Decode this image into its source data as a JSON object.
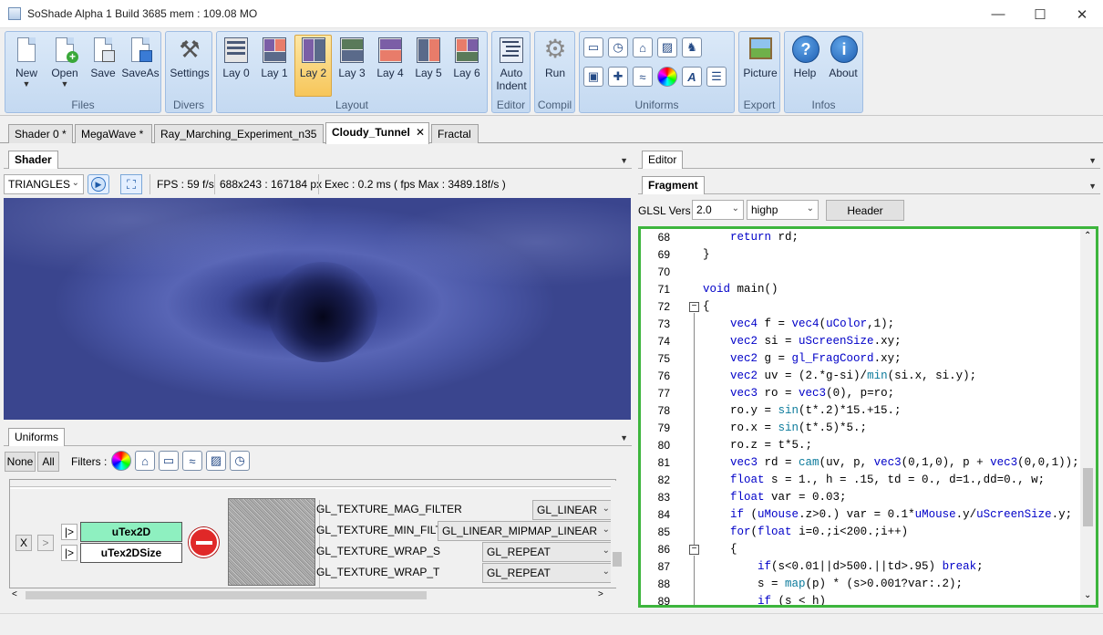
{
  "window": {
    "title": "SoShade Alpha 1 Build 3685 mem : 109.08 MO",
    "minimize": "—",
    "maximize": "☐",
    "close": "✕"
  },
  "ribbon": {
    "files": {
      "label": "Files",
      "new": "New",
      "open": "Open",
      "save": "Save",
      "saveas": "SaveAs"
    },
    "divers": {
      "label": "Divers",
      "settings": "Settings"
    },
    "layout": {
      "label": "Layout",
      "layouts": [
        "Lay 0",
        "Lay 1",
        "Lay 2",
        "Lay 3",
        "Lay 4",
        "Lay 5",
        "Lay 6"
      ],
      "active": "Lay 2"
    },
    "editor": {
      "label": "Editor",
      "auto_indent_1": "Auto",
      "auto_indent_2": "Indent"
    },
    "compil": {
      "label": "Compil",
      "run": "Run"
    },
    "uniforms": {
      "label": "Uniforms"
    },
    "export": {
      "label": "Export",
      "picture": "Picture"
    },
    "infos": {
      "label": "Infos",
      "help": "Help",
      "about": "About"
    }
  },
  "doc_tabs": [
    "Shader 0 *",
    "MegaWave *",
    "Ray_Marching_Experiment_n35",
    "Cloudy_Tunnel",
    "Fractal"
  ],
  "active_doc_tab": "Cloudy_Tunnel",
  "shader_panel": {
    "tab": "Shader",
    "mode": "TRIANGLES",
    "fps": "FPS : 59 f/s",
    "size": "688x243 : 167184 px",
    "exec": "Exec : 0.2 ms ( fps Max : 3489.18f/s )"
  },
  "uniforms_panel": {
    "tab": "Uniforms",
    "none": "None",
    "all": "All",
    "filters": "Filters :",
    "x": "X",
    "gt": ">",
    "play1": "|>",
    "play2": "|>",
    "tex_name": "uTex2D",
    "tex_size": "uTex2DSize",
    "params": [
      {
        "name": "GL_TEXTURE_MAG_FILTER",
        "value": "GL_LINEAR"
      },
      {
        "name": "GL_TEXTURE_MIN_FILTER",
        "value": "GL_LINEAR_MIPMAP_LINEAR"
      },
      {
        "name": "GL_TEXTURE_WRAP_S",
        "value": "GL_REPEAT"
      },
      {
        "name": "GL_TEXTURE_WRAP_T",
        "value": "GL_REPEAT"
      }
    ]
  },
  "editor_panel": {
    "tab": "Editor",
    "subtab": "Fragment",
    "glsl_label": "GLSL Vers :",
    "glsl_version": "2.0",
    "precision": "highp",
    "header_button": "Header",
    "lines": [
      {
        "n": "68",
        "code": "    return rd;"
      },
      {
        "n": "69",
        "code": "}"
      },
      {
        "n": "70",
        "code": ""
      },
      {
        "n": "71",
        "code": "void main()"
      },
      {
        "n": "72",
        "code": "{"
      },
      {
        "n": "73",
        "code": "    vec4 f = vec4(uColor,1);"
      },
      {
        "n": "74",
        "code": "    vec2 si = uScreenSize.xy;"
      },
      {
        "n": "75",
        "code": "    vec2 g = gl_FragCoord.xy;"
      },
      {
        "n": "76",
        "code": "    vec2 uv = (2.*g-si)/min(si.x, si.y);"
      },
      {
        "n": "77",
        "code": "    vec3 ro = vec3(0), p=ro;"
      },
      {
        "n": "78",
        "code": "    ro.y = sin(t*.2)*15.+15.;"
      },
      {
        "n": "79",
        "code": "    ro.x = sin(t*.5)*5.;"
      },
      {
        "n": "80",
        "code": "    ro.z = t*5.;"
      },
      {
        "n": "81",
        "code": "    vec3 rd = cam(uv, p, vec3(0,1,0), p + vec3(0,0,1));"
      },
      {
        "n": "82",
        "code": "    float s = 1., h = .15, td = 0., d=1.,dd=0., w;"
      },
      {
        "n": "83",
        "code": "    float var = 0.03;"
      },
      {
        "n": "84",
        "code": "    if (uMouse.z>0.) var = 0.1*uMouse.y/uScreenSize.y;"
      },
      {
        "n": "85",
        "code": "    for(float i=0.;i<200.;i++)"
      },
      {
        "n": "86",
        "code": "    {"
      },
      {
        "n": "87",
        "code": "        if(s<0.01||d>500.||td>.95) break;"
      },
      {
        "n": "88",
        "code": "        s = map(p) * (s>0.001?var:.2);"
      },
      {
        "n": "89",
        "code": "        if (s < h)"
      }
    ]
  }
}
